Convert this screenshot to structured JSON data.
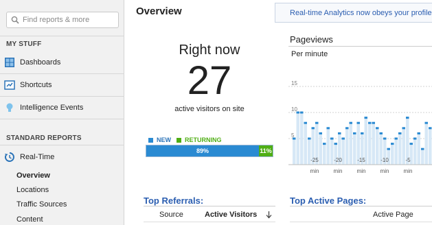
{
  "sidebar": {
    "search": {
      "placeholder": "Find reports & more"
    },
    "my_stuff_header": "MY STUFF",
    "items": [
      {
        "label": "Dashboards",
        "icon": "dashboard-icon"
      },
      {
        "label": "Shortcuts",
        "icon": "shortcut-icon"
      },
      {
        "label": "Intelligence Events",
        "icon": "lightbulb-icon"
      }
    ],
    "standard_reports_header": "STANDARD REPORTS",
    "realtime": {
      "label": "Real-Time",
      "icon": "clock-icon"
    },
    "realtime_sub": [
      "Overview",
      "Locations",
      "Traffic Sources",
      "Content"
    ]
  },
  "main": {
    "title": "Overview",
    "notice": "Real-time Analytics now obeys your profile filters",
    "right_now": {
      "title": "Right now",
      "count": "27",
      "subtitle": "active visitors on site"
    },
    "visitor_split": {
      "new_label": "NEW",
      "returning_label": "RETURNING",
      "new_pct": "89%",
      "returning_pct": "11%",
      "new_fraction": 0.89,
      "new_color": "#2a8ad2",
      "returning_color": "#4fae14"
    },
    "pageviews": {
      "title": "Pageviews",
      "subtitle": "Per minute",
      "y_ticks": [
        "15",
        "10",
        "5"
      ],
      "x_ticks": [
        "-25",
        "-20",
        "-15",
        "-10",
        "-5"
      ],
      "x_unit": "min",
      "values": [
        5,
        10,
        10,
        8,
        5,
        7,
        8,
        6,
        4,
        7,
        5,
        4,
        6,
        5,
        7,
        8,
        6,
        8,
        6,
        9,
        8,
        8,
        7,
        6,
        5,
        3,
        4,
        5,
        6,
        7,
        9,
        4,
        5,
        6,
        3,
        8,
        7,
        3
      ],
      "bar_color": "#d7e8f6",
      "line_color": "#2a8ad2"
    },
    "top_referrals": {
      "title": "Top Referrals:",
      "columns": [
        "Source",
        "Active Visitors"
      ]
    },
    "top_active_pages": {
      "title": "Top Active Pages:",
      "columns": [
        "Active Page"
      ]
    }
  }
}
